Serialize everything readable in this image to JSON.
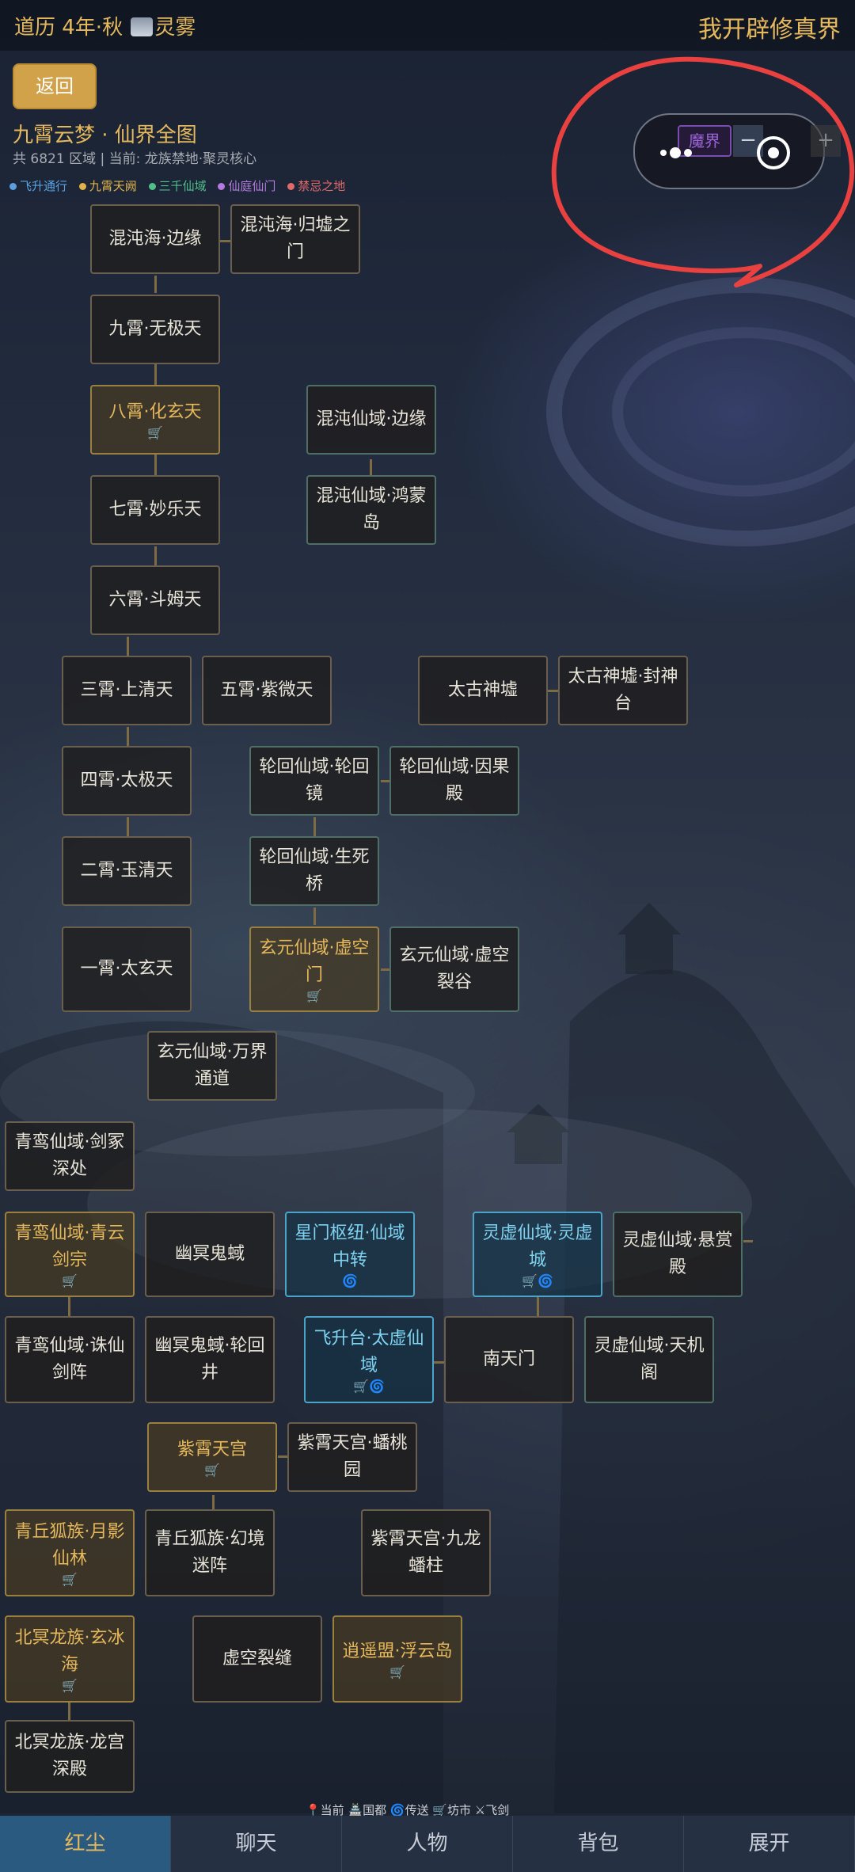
{
  "status_bar": {
    "left": "道历 4年·秋",
    "mist_label": "灵雾",
    "right": "我开辟修真界"
  },
  "back_button": "返回",
  "map": {
    "title": "九霄云梦 · 仙界全图",
    "subtitle": "共 6821 区域 | 当前: 龙族禁地·聚灵核心",
    "legend": [
      {
        "label": "飞升通行",
        "color": "#5aa0e0"
      },
      {
        "label": "九霄天阙",
        "color": "#e0b24a"
      },
      {
        "label": "三千仙域",
        "color": "#4fbf8a"
      },
      {
        "label": "仙庭仙门",
        "color": "#b57ae0"
      },
      {
        "label": "禁忌之地",
        "color": "#e06a6a"
      }
    ],
    "controls": {
      "realm_chip": "魔界",
      "zoom_out": "−",
      "zoom_in": "+"
    }
  },
  "nodes": {
    "n1": "混沌海·边缘",
    "n2": "混沌海·归墟之门",
    "n3": "九霄·无极天",
    "n4": "八霄·化玄天",
    "n5": "混沌仙域·边缘",
    "n6": "七霄·妙乐天",
    "n7": "混沌仙域·鸿蒙岛",
    "n8": "六霄·斗姆天",
    "n9": "三霄·上清天",
    "n10": "五霄·紫微天",
    "n11": "太古神墟",
    "n12": "太古神墟·封神台",
    "n13": "四霄·太极天",
    "n14": "轮回仙域·轮回镜",
    "n15": "轮回仙域·因果殿",
    "n16": "二霄·玉清天",
    "n17": "轮回仙域·生死桥",
    "n18": "一霄·太玄天",
    "n19": "玄元仙域·虚空门",
    "n20": "玄元仙域·虚空裂谷",
    "n21": "玄元仙域·万界通道",
    "n22": "青鸾仙域·剑冢深处",
    "n23": "青鸾仙域·青云剑宗",
    "n24": "幽冥鬼蜮",
    "n25": "星门枢纽·仙域中转",
    "n26": "灵虚仙域·灵虚城",
    "n27": "灵虚仙域·悬赏殿",
    "n28": "青鸾仙域·诛仙剑阵",
    "n29": "幽冥鬼蜮·轮回井",
    "n30": "飞升台·太虚仙域",
    "n31": "南天门",
    "n32": "灵虚仙域·天机阁",
    "n33": "紫霄天宫",
    "n34": "紫霄天宫·蟠桃园",
    "n35": "青丘狐族·月影仙林",
    "n36": "青丘狐族·幻境迷阵",
    "n37": "紫霄天宫·九龙蟠柱",
    "n38": "北冥龙族·玄冰海",
    "n39": "虚空裂缝",
    "n40": "逍遥盟·浮云岛",
    "n41": "北冥龙族·龙宫深殿"
  },
  "bottom_legend": "📍当前 🏯国都 🌀传送 🛒坊市 ⚔飞剑",
  "bottom_nav": [
    "红尘",
    "聊天",
    "人物",
    "背包",
    "展开"
  ],
  "colors": {
    "gold": "#e6b85c",
    "cyan": "#7fd3f0",
    "annotation_red": "#e8413f",
    "active_tab": "#2b5a80"
  }
}
